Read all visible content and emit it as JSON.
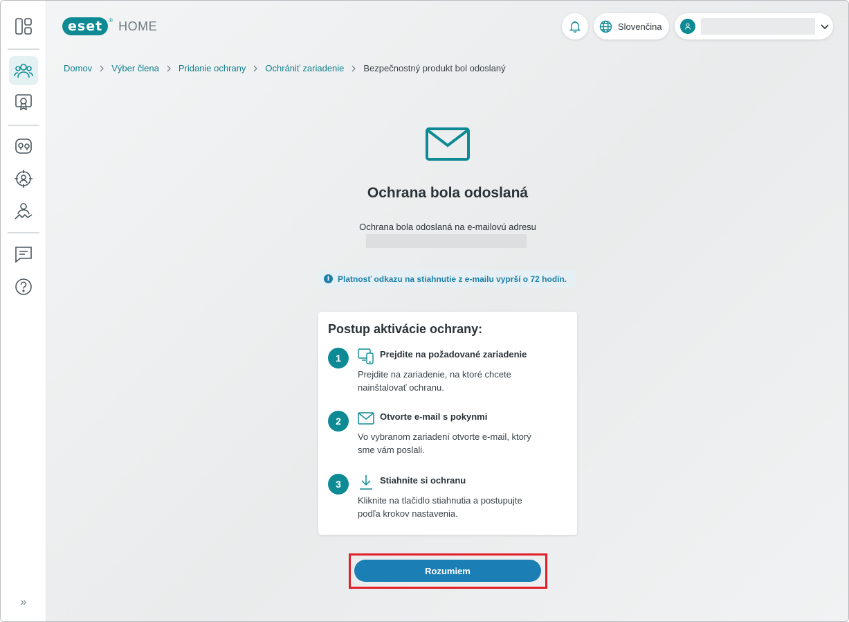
{
  "header": {
    "logo_mark": "eset",
    "logo_product": "HOME",
    "notifications_icon": "bell-icon",
    "language": "Slovenčina",
    "account_redacted": true
  },
  "sidebar": {
    "items": [
      {
        "icon": "dashboard-icon",
        "active": false
      },
      {
        "icon": "family-members-icon",
        "active": true
      },
      {
        "icon": "license-certificate-icon",
        "active": false
      },
      {
        "icon": "devices-security-icon",
        "active": false
      },
      {
        "icon": "anti-theft-icon",
        "active": false
      },
      {
        "icon": "parental-control-icon",
        "active": false
      },
      {
        "icon": "feedback-icon",
        "active": false
      },
      {
        "icon": "help-icon",
        "active": false
      }
    ],
    "expand_label": "»"
  },
  "breadcrumb": {
    "items": [
      "Domov",
      "Výber člena",
      "Pridanie ochrany",
      "Ochrániť zariadenie"
    ],
    "current": "Bezpečnostný produkt bol odoslaný"
  },
  "main": {
    "title": "Ochrana bola odoslaná",
    "subtitle": "Ochrana bola odoslaná na e-mailovú adresu",
    "info_note": "Platnosť odkazu na stiahnutie z e-mailu vyprší o 72 hodín.",
    "card": {
      "title": "Postup aktivácie ochrany:",
      "steps": [
        {
          "num": "1",
          "icon": "devices-icon",
          "heading": "Prejdite na požadované zariadenie",
          "line1": "Prejdite na zariadenie, na ktoré chcete",
          "line2": "nainštalovať ochranu."
        },
        {
          "num": "2",
          "icon": "mail-icon",
          "heading": "Otvorte e-mail s pokynmi",
          "line1": "Vo vybranom zariadení otvorte e-mail, ktorý",
          "line2": "sme vám poslali."
        },
        {
          "num": "3",
          "icon": "download-icon",
          "heading": "Stiahnite si ochranu",
          "line1": "Kliknite na tlačidlo stiahnutia a postupujte",
          "line2": "podľa krokov nastavenia."
        }
      ]
    },
    "cta_label": "Rozumiem"
  },
  "colors": {
    "accent_teal": "#0d8a94",
    "button_blue": "#1b7eb5",
    "highlight_red": "#e01f26",
    "info_blue": "#1e7fa8"
  }
}
